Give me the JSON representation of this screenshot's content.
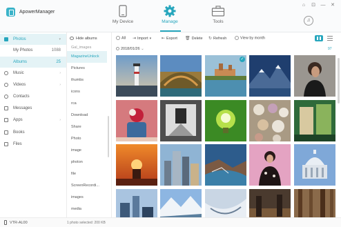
{
  "app": {
    "title": "ApowerManager"
  },
  "nav": {
    "items": [
      {
        "label": "My Device"
      },
      {
        "label": "Manage"
      },
      {
        "label": "Tools"
      }
    ]
  },
  "window_controls": [
    "⌂",
    "⊡",
    "—",
    "✕"
  ],
  "sidebar": {
    "items": [
      {
        "label": "Photos",
        "icon": "image-icon"
      },
      {
        "label": "My Photos",
        "count": "1088"
      },
      {
        "label": "Albums",
        "count": "25"
      },
      {
        "label": "Music",
        "icon": "music-icon"
      },
      {
        "label": "Videos",
        "icon": "video-icon"
      },
      {
        "label": "Contacts",
        "icon": "contacts-icon"
      },
      {
        "label": "Messages",
        "icon": "message-icon"
      },
      {
        "label": "Apps",
        "icon": "apps-icon"
      },
      {
        "label": "Books",
        "icon": "book-icon"
      },
      {
        "label": "Files",
        "icon": "file-icon"
      }
    ]
  },
  "albums": {
    "hide_label": "Hide albums",
    "items": [
      "Gal_images",
      "MagazineUnlock",
      "Pictures",
      "thumbs",
      "icons",
      "rca",
      "Download",
      "Share",
      "Photo",
      "image",
      "photon",
      "file",
      "ScreenRecordi...",
      "images",
      "media"
    ]
  },
  "toolbar": {
    "all": "All",
    "import": "Import",
    "export": "Export",
    "delete": "Delete",
    "refresh": "Refresh",
    "view_by_month": "View by month"
  },
  "grid": {
    "date": "2018/01/26",
    "selected_count": "97"
  },
  "status": {
    "device": "VTR-AL00",
    "selection": "1 photo selected: 200 KB"
  },
  "colors": {
    "accent": "#26a6bd",
    "active_bg": "#e4f3f6"
  }
}
